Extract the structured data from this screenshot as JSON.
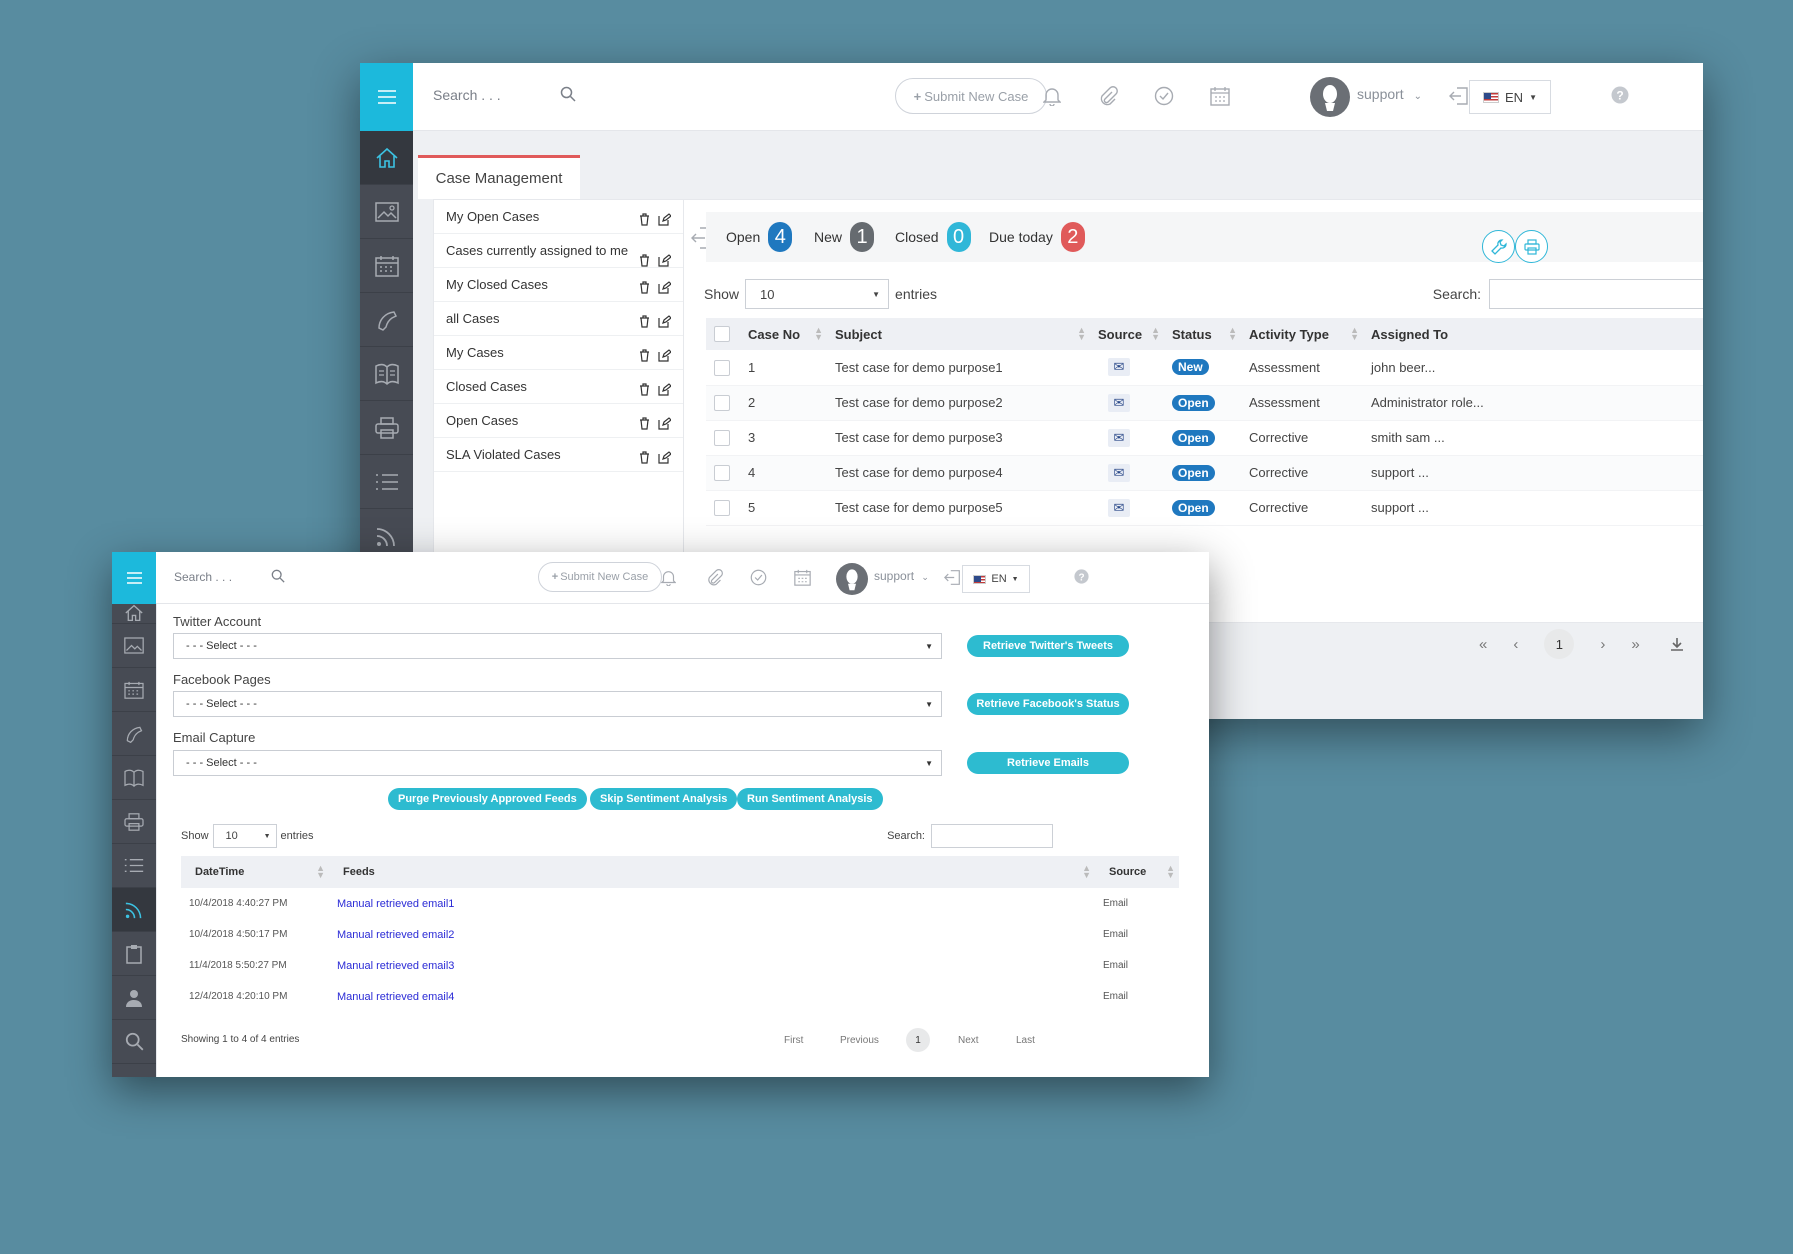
{
  "colors": {
    "accent": "#1cb9dc",
    "sidebar": "#474b54",
    "badge_open": "#1f78bf",
    "badge_new": "#666b70",
    "badge_closed": "#30b7d8",
    "badge_due": "#e05a5a",
    "feed_link": "#2b2bd6"
  },
  "back": {
    "search_placeholder": "Search . . .",
    "submit_label": "Submit New Case",
    "user": "support",
    "lang": "EN",
    "tab_label": "Case Management",
    "filters": [
      {
        "label": "My Open Cases"
      },
      {
        "label": "Cases currently assigned to me"
      },
      {
        "label": "My Closed Cases"
      },
      {
        "label": "all Cases"
      },
      {
        "label": "My Cases"
      },
      {
        "label": "Closed Cases"
      },
      {
        "label": "Open Cases"
      },
      {
        "label": "SLA Violated Cases"
      }
    ],
    "status": [
      {
        "label": "Open",
        "count": "4"
      },
      {
        "label": "New",
        "count": "1"
      },
      {
        "label": "Closed",
        "count": "0"
      },
      {
        "label": "Due today",
        "count": "2"
      }
    ],
    "show_label": "Show",
    "show_value": "10",
    "entries_label": "entries",
    "search_label": "Search:",
    "columns": [
      "Case No",
      "Subject",
      "Source",
      "Status",
      "Activity Type",
      "Assigned To"
    ],
    "rows": [
      {
        "no": "1",
        "subject": "Test case for demo purpose1",
        "status": "New",
        "activity": "Assessment",
        "assigned": "john beer..."
      },
      {
        "no": "2",
        "subject": "Test case for demo purpose2",
        "status": "Open",
        "activity": "Assessment",
        "assigned": "Administrator role..."
      },
      {
        "no": "3",
        "subject": "Test case for demo purpose3",
        "status": "Open",
        "activity": "Corrective",
        "assigned": "smith sam ..."
      },
      {
        "no": "4",
        "subject": "Test case for demo purpose4",
        "status": "Open",
        "activity": "Corrective",
        "assigned": "support ..."
      },
      {
        "no": "5",
        "subject": "Test case for demo purpose5",
        "status": "Open",
        "activity": "Corrective",
        "assigned": "support ..."
      }
    ],
    "pagination": {
      "first": "«",
      "prev": "‹",
      "page": "1",
      "next": "›",
      "last": "»"
    }
  },
  "front": {
    "search_placeholder": "Search . . .",
    "submit_label": "Submit New Case",
    "user": "support",
    "lang": "EN",
    "twitter_label": "Twitter Account",
    "facebook_label": "Facebook Pages",
    "email_label": "Email Capture",
    "select_placeholder": "- - - Select - - -",
    "btn_twitter": "Retrieve Twitter's Tweets",
    "btn_facebook": "Retrieve Facebook's Status",
    "btn_emails": "Retrieve Emails",
    "btn_purge": "Purge Previously Approved Feeds",
    "btn_skip": "Skip Sentiment Analysis",
    "btn_run": "Run Sentiment Analysis",
    "show_label": "Show",
    "show_value": "10",
    "entries_label": "entries",
    "search_label": "Search:",
    "columns": [
      "DateTime",
      "Feeds",
      "Source"
    ],
    "rows": [
      {
        "datetime": "10/4/2018 4:40:27 PM",
        "feed": "Manual retrieved email1",
        "source": "Email"
      },
      {
        "datetime": "10/4/2018 4:50:17 PM",
        "feed": "Manual retrieved email2",
        "source": "Email"
      },
      {
        "datetime": "11/4/2018 5:50:27 PM",
        "feed": "Manual retrieved email3",
        "source": "Email"
      },
      {
        "datetime": "12/4/2018 4:20:10 PM",
        "feed": "Manual retrieved email4",
        "source": "Email"
      }
    ],
    "info": "Showing 1 to 4 of 4 entries",
    "pagination": {
      "first": "First",
      "prev": "Previous",
      "page": "1",
      "next": "Next",
      "last": "Last"
    }
  }
}
